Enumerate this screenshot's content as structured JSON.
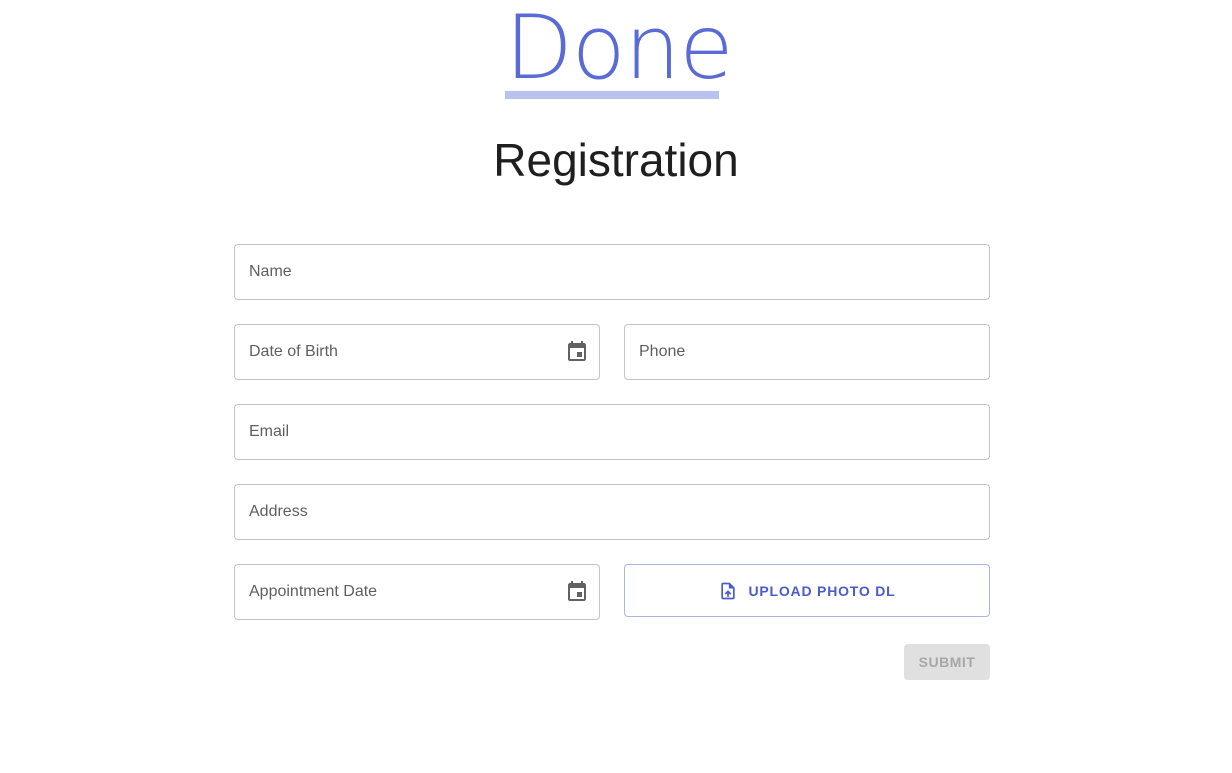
{
  "header": {
    "link_text": "Done",
    "title": "Registration"
  },
  "form": {
    "name_label": "Name",
    "dob_label": "Date of Birth",
    "phone_label": "Phone",
    "email_label": "Email",
    "address_label": "Address",
    "appointment_label": "Appointment Date",
    "upload_label": "UPLOAD PHOTO DL",
    "submit_label": "SUBMIT"
  },
  "icons": {
    "calendar": "calendar-icon",
    "upload": "file-upload-icon"
  },
  "colors": {
    "accent": "#5b6bd6",
    "accent_underline": "#b9c1ee",
    "button_text": "#4a5bcc",
    "field_border": "#c4c4c4",
    "disabled_bg": "#e0e0e0",
    "disabled_text": "#a6a6a6"
  }
}
